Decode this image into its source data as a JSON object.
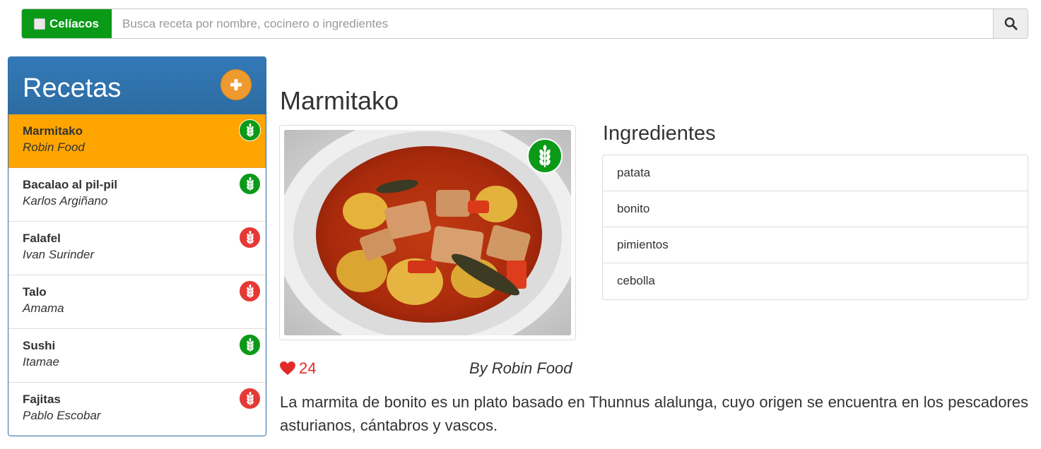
{
  "search": {
    "filter_label": "Celíacos",
    "placeholder": "Busca receta por nombre, cocinero o ingredientes",
    "button_icon": "search-icon"
  },
  "sidebar": {
    "title": "Recetas",
    "add_icon": "plus-icon",
    "recipes": [
      {
        "name": "Marmitako",
        "author": "Robin Food",
        "gluten_free": true,
        "active": true
      },
      {
        "name": "Bacalao al pil-pil",
        "author": "Karlos Argiñano",
        "gluten_free": true,
        "active": false
      },
      {
        "name": "Falafel",
        "author": "Ivan Surinder",
        "gluten_free": false,
        "active": false
      },
      {
        "name": "Talo",
        "author": "Amama",
        "gluten_free": false,
        "active": false
      },
      {
        "name": "Sushi",
        "author": "Itamae",
        "gluten_free": true,
        "active": false
      },
      {
        "name": "Fajitas",
        "author": "Pablo Escobar",
        "gluten_free": false,
        "active": false
      }
    ]
  },
  "recipe": {
    "title": "Marmitako",
    "likes": "24",
    "byline": "By Robin Food",
    "description": "La marmita de bonito es un plato basado en Thunnus alalunga, cuyo origen se encuentra en los pescadores asturianos, cántabros y vascos.",
    "ingredients_title": "Ingredientes",
    "ingredients": [
      "patata",
      "bonito",
      "pimientos",
      "cebolla"
    ]
  },
  "colors": {
    "accent_blue": "#337ab7",
    "active_orange": "#ffa500",
    "gluten_free_green": "#0a9a17",
    "contains_gluten_red": "#e53935",
    "like_red": "#e32a2a",
    "add_button_orange": "#ee9a2e"
  }
}
